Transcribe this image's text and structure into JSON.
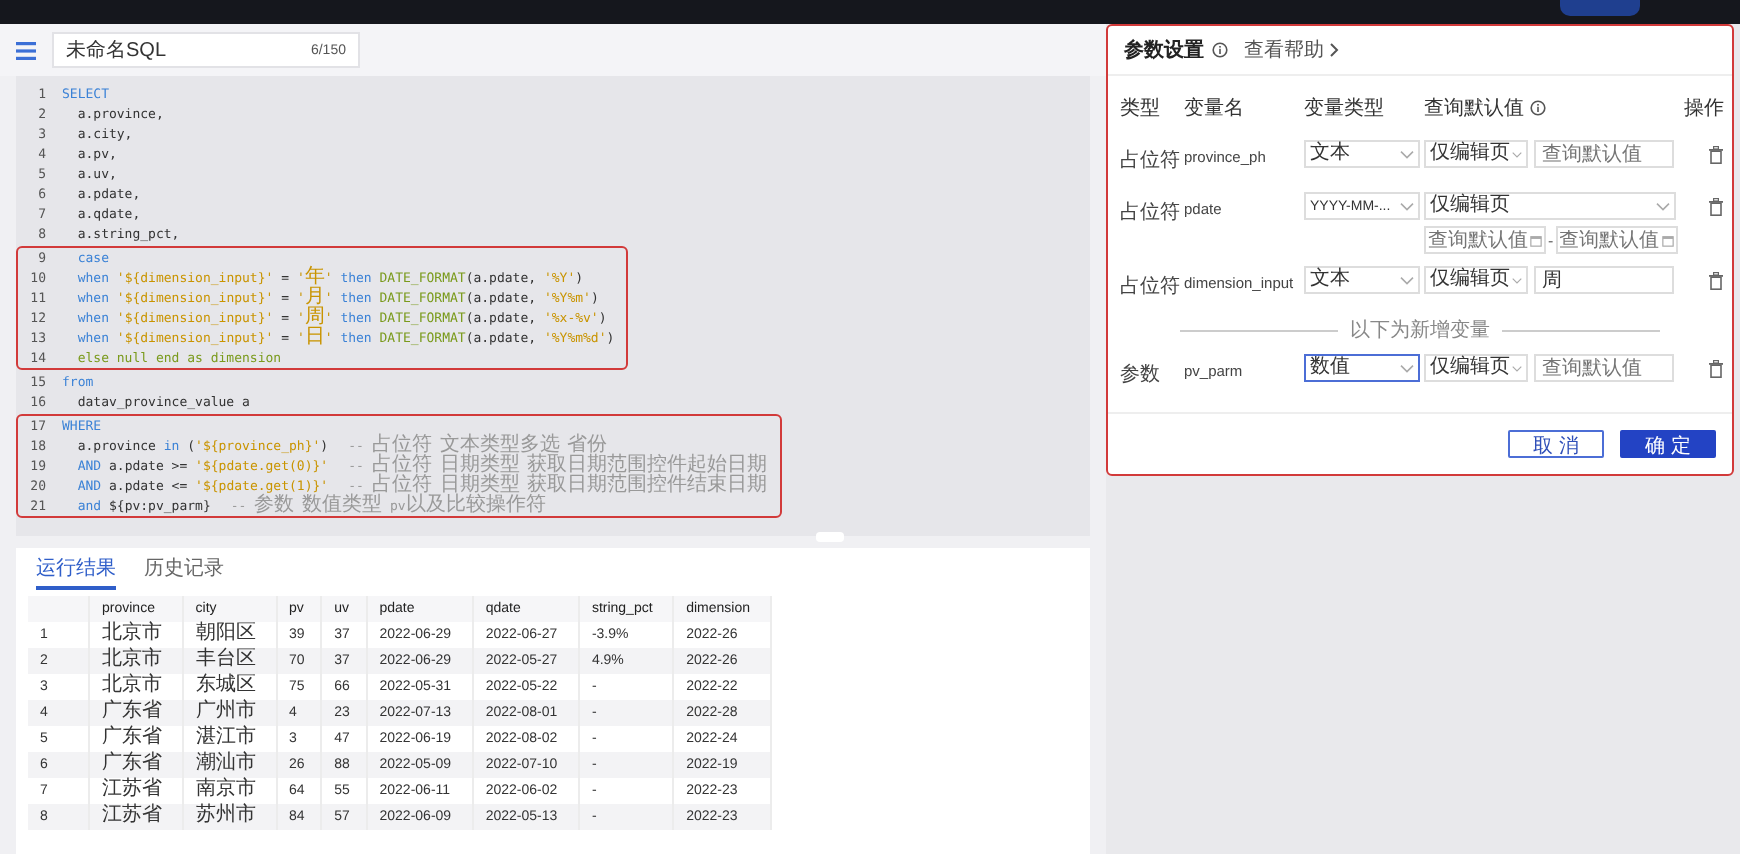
{
  "editor": {
    "name": "未命名SQL",
    "counter": "6/150",
    "blocks": [
      {
        "marked": false,
        "lines": [
          {
            "no": "1",
            "parts": [
              {
                "kind": "kw",
                "text": "SELECT"
              }
            ]
          },
          {
            "no": "2",
            "parts": [
              {
                "kind": "plain",
                "text": "  a.province,"
              }
            ]
          },
          {
            "no": "3",
            "parts": [
              {
                "kind": "plain",
                "text": "  a.city,"
              }
            ]
          },
          {
            "no": "4",
            "parts": [
              {
                "kind": "plain",
                "text": "  a.pv,"
              }
            ]
          },
          {
            "no": "5",
            "parts": [
              {
                "kind": "plain",
                "text": "  a.uv,"
              }
            ]
          },
          {
            "no": "6",
            "parts": [
              {
                "kind": "plain",
                "text": "  a.pdate,"
              }
            ]
          },
          {
            "no": "7",
            "parts": [
              {
                "kind": "plain",
                "text": "  a.qdate,"
              }
            ]
          },
          {
            "no": "8",
            "parts": [
              {
                "kind": "plain",
                "text": "  a.string_pct,"
              }
            ]
          }
        ]
      },
      {
        "marked": true,
        "lines": [
          {
            "no": "9",
            "parts": [
              {
                "kind": "kw",
                "text": "  case"
              }
            ]
          },
          {
            "no": "10",
            "parts": [
              {
                "kind": "kw",
                "text": "  when "
              },
              {
                "kind": "str",
                "text": "'${dimension_input}'"
              },
              {
                "kind": "plain",
                "text": " = "
              },
              {
                "kind": "str",
                "text": "'年'"
              },
              {
                "kind": "kw",
                "text": " then "
              },
              {
                "kind": "fn",
                "text": "DATE_FORMAT"
              },
              {
                "kind": "plain",
                "text": "(a.pdate, "
              },
              {
                "kind": "str",
                "text": "'%Y'"
              },
              {
                "kind": "plain",
                "text": ")"
              }
            ]
          },
          {
            "no": "11",
            "parts": [
              {
                "kind": "kw",
                "text": "  when "
              },
              {
                "kind": "str",
                "text": "'${dimension_input}'"
              },
              {
                "kind": "plain",
                "text": " = "
              },
              {
                "kind": "str",
                "text": "'月'"
              },
              {
                "kind": "kw",
                "text": " then "
              },
              {
                "kind": "fn",
                "text": "DATE_FORMAT"
              },
              {
                "kind": "plain",
                "text": "(a.pdate, "
              },
              {
                "kind": "str",
                "text": "'%Y%m'"
              },
              {
                "kind": "plain",
                "text": ")"
              }
            ]
          },
          {
            "no": "12",
            "parts": [
              {
                "kind": "kw",
                "text": "  when "
              },
              {
                "kind": "str",
                "text": "'${dimension_input}'"
              },
              {
                "kind": "plain",
                "text": " = "
              },
              {
                "kind": "str",
                "text": "'周'"
              },
              {
                "kind": "kw",
                "text": " then "
              },
              {
                "kind": "fn",
                "text": "DATE_FORMAT"
              },
              {
                "kind": "plain",
                "text": "(a.pdate, "
              },
              {
                "kind": "str",
                "text": "'%x-%v'"
              },
              {
                "kind": "plain",
                "text": ")"
              }
            ]
          },
          {
            "no": "13",
            "parts": [
              {
                "kind": "kw",
                "text": "  when "
              },
              {
                "kind": "str",
                "text": "'${dimension_input}'"
              },
              {
                "kind": "plain",
                "text": " = "
              },
              {
                "kind": "str",
                "text": "'日'"
              },
              {
                "kind": "kw",
                "text": " then "
              },
              {
                "kind": "fn",
                "text": "DATE_FORMAT"
              },
              {
                "kind": "plain",
                "text": "(a.pdate, "
              },
              {
                "kind": "str",
                "text": "'%Y%m%d'"
              },
              {
                "kind": "plain",
                "text": ")"
              }
            ]
          },
          {
            "no": "14",
            "parts": [
              {
                "kind": "fn",
                "text": "  else null end as dimension"
              }
            ]
          }
        ]
      },
      {
        "marked": false,
        "lines": [
          {
            "no": "15",
            "parts": [
              {
                "kind": "kw",
                "text": "from"
              }
            ]
          },
          {
            "no": "16",
            "parts": [
              {
                "kind": "plain",
                "text": "  datav_province_value a"
              }
            ]
          }
        ]
      },
      {
        "marked": true,
        "lines": [
          {
            "no": "17",
            "parts": [
              {
                "kind": "kw",
                "text": "WHERE"
              }
            ]
          },
          {
            "no": "18",
            "parts": [
              {
                "kind": "plain",
                "text": "  a.province "
              },
              {
                "kind": "kw",
                "text": "in"
              },
              {
                "kind": "plain",
                "text": " ("
              },
              {
                "kind": "str",
                "text": "'${province_ph}'"
              },
              {
                "kind": "plain",
                "text": ")"
              },
              {
                "kind": "comment",
                "text": "-- 占位符 文本类型多选 省份"
              }
            ]
          },
          {
            "no": "19",
            "parts": [
              {
                "kind": "kw",
                "text": "  AND"
              },
              {
                "kind": "plain",
                "text": " a.pdate >= "
              },
              {
                "kind": "str",
                "text": "'${pdate.get(0)}'"
              },
              {
                "kind": "comment",
                "text": "-- 占位符 日期类型 获取日期范围控件起始日期"
              }
            ]
          },
          {
            "no": "20",
            "parts": [
              {
                "kind": "kw",
                "text": "  AND"
              },
              {
                "kind": "plain",
                "text": " a.pdate <= "
              },
              {
                "kind": "str",
                "text": "'${pdate.get(1)}'"
              },
              {
                "kind": "comment",
                "text": "-- 占位符 日期类型 获取日期范围控件结束日期"
              }
            ]
          },
          {
            "no": "21",
            "parts": [
              {
                "kind": "kw",
                "text": "  and"
              },
              {
                "kind": "plain",
                "text": " ${pv:pv_parm}"
              },
              {
                "kind": "comment",
                "text": "-- 参数 数值类型 pv以及比较操作符"
              }
            ]
          }
        ]
      }
    ]
  },
  "results": {
    "tabs": [
      {
        "label": "运行结果",
        "selected": true
      },
      {
        "label": "历史记录",
        "selected": false
      }
    ],
    "columns": [
      "",
      "province",
      "city",
      "pv",
      "uv",
      "pdate",
      "qdate",
      "string_pct",
      "dimension"
    ],
    "rows": [
      [
        "1",
        "北京市",
        "朝阳区",
        "39",
        "37",
        "2022-06-29",
        "2022-06-27",
        "-3.9%",
        "2022-26"
      ],
      [
        "2",
        "北京市",
        "丰台区",
        "70",
        "37",
        "2022-06-29",
        "2022-05-27",
        "4.9%",
        "2022-26"
      ],
      [
        "3",
        "北京市",
        "东城区",
        "75",
        "66",
        "2022-05-31",
        "2022-05-22",
        "-",
        "2022-22"
      ],
      [
        "4",
        "广东省",
        "广州市",
        "4",
        "23",
        "2022-07-13",
        "2022-08-01",
        "-",
        "2022-28"
      ],
      [
        "5",
        "广东省",
        "湛江市",
        "3",
        "47",
        "2022-06-19",
        "2022-08-02",
        "-",
        "2022-24"
      ],
      [
        "6",
        "广东省",
        "潮汕市",
        "26",
        "88",
        "2022-05-09",
        "2022-07-10",
        "-",
        "2022-19"
      ],
      [
        "7",
        "江苏省",
        "南京市",
        "64",
        "55",
        "2022-06-11",
        "2022-06-02",
        "-",
        "2022-23"
      ],
      [
        "8",
        "江苏省",
        "苏州市",
        "84",
        "57",
        "2022-06-09",
        "2022-05-13",
        "-",
        "2022-23"
      ]
    ]
  },
  "params": {
    "title": "参数设置",
    "help": "查看帮助",
    "headers": [
      "类型",
      "变量名",
      "变量类型",
      "查询默认值",
      "操作"
    ],
    "rows": [
      {
        "type": "占位符",
        "name": "province_ph",
        "var_type": "文本",
        "var_focused": false,
        "mode": "仅编辑页",
        "kind": "single",
        "default_placeholder": "查询默认值"
      },
      {
        "type": "占位符",
        "name": "pdate",
        "var_type": "YYYY-MM-...",
        "var_focused": false,
        "mode": "仅编辑页",
        "kind": "range",
        "start_placeholder": "查询默认值",
        "separator": "-",
        "end_placeholder": "查询默认值"
      },
      {
        "type": "占位符",
        "name": "dimension_input",
        "var_type": "文本",
        "var_focused": false,
        "mode": "仅编辑页",
        "kind": "single",
        "default_value": "周"
      },
      {
        "kind": "divider",
        "label": "以下为新增变量"
      },
      {
        "type": "参数",
        "name": "pv_parm",
        "var_type": "数值",
        "var_focused": true,
        "mode": "仅编辑页",
        "kind": "single",
        "default_placeholder": "查询默认值"
      }
    ],
    "buttons": {
      "cancel": "取 消",
      "ok": "确 定"
    }
  }
}
